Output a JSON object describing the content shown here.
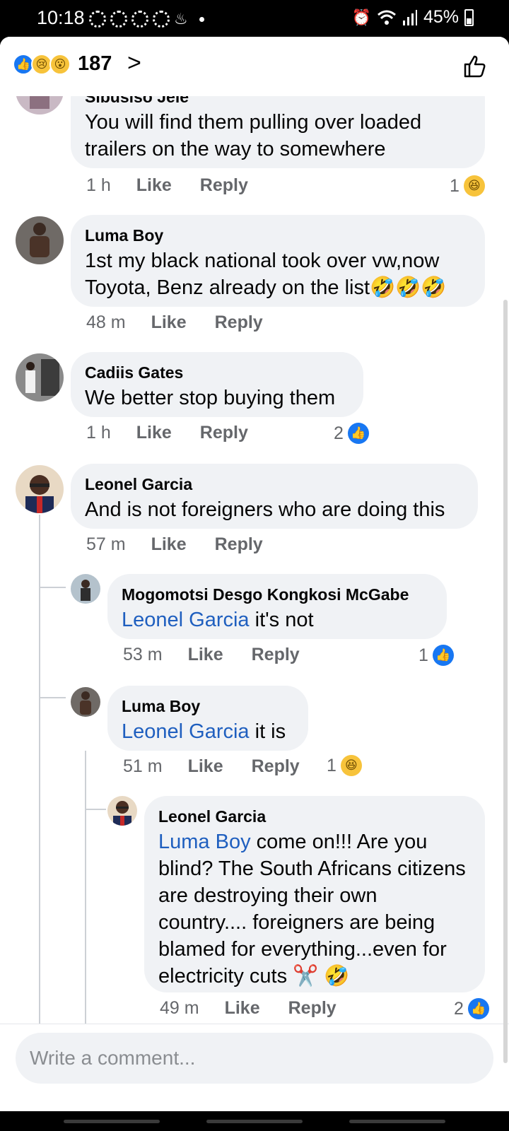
{
  "status_bar": {
    "time": "10:18",
    "battery": "45%"
  },
  "header": {
    "reaction_icons": [
      "like-icon",
      "sad-icon",
      "wow-icon"
    ],
    "reaction_count": "187",
    "chevron": ">"
  },
  "comments": [
    {
      "name": "Sibusiso Jele",
      "text": "You will find them pulling over loaded trailers on the way to somewhere",
      "time": "1 h",
      "like": "Like",
      "reply": "Reply",
      "reactions": "1",
      "reaction_icon": "haha-icon"
    },
    {
      "name": "Luma Boy",
      "text": "1st my black national took over vw,now Toyota, Benz already on the list🤣🤣🤣",
      "time": "48 m",
      "like": "Like",
      "reply": "Reply"
    },
    {
      "name": "Cadiis Gates",
      "text": "We better stop buying them",
      "time": "1 h",
      "like": "Like",
      "reply": "Reply",
      "reactions": "2",
      "reaction_icon": "like-icon"
    },
    {
      "name": "Leonel Garcia",
      "text": "And is not foreigners who are doing this",
      "time": "57 m",
      "like": "Like",
      "reply": "Reply",
      "replies": [
        {
          "name": "Mogomotsi Desgo Kongkosi McGabe",
          "tag": "Leonel Garcia",
          "text": " it's not",
          "time": "53 m",
          "like": "Like",
          "reply": "Reply",
          "reactions": "1",
          "reaction_icon": "like-icon"
        },
        {
          "name": "Luma Boy",
          "tag": "Leonel Garcia",
          "text": " it is",
          "time": "51 m",
          "like": "Like",
          "reply": "Reply",
          "reactions": "1",
          "reaction_icon": "haha-icon",
          "replies": [
            {
              "name": "Leonel Garcia",
              "tag": "Luma Boy",
              "text": "  come on!!!  Are you blind? The South Africans citizens are destroying their own country.... foreigners are being blamed for everything...even for electricity cuts ✂️ 🤣",
              "time": "49 m",
              "like": "Like",
              "reply": "Reply",
              "reactions": "2",
              "reaction_icon": "like-icon"
            }
          ]
        }
      ]
    }
  ],
  "composer": {
    "placeholder": "Write a comment..."
  },
  "colors": {
    "accent": "#1877f2",
    "bubble": "#f0f2f5",
    "meta": "#65676b",
    "tag": "#1f5fbf"
  }
}
